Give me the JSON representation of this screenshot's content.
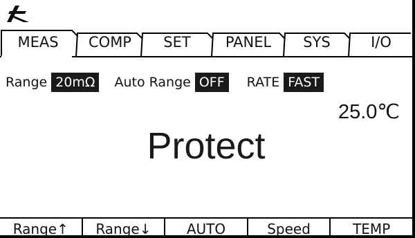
{
  "tabs": [
    {
      "label": "MEAS",
      "active": true
    },
    {
      "label": "COMP",
      "active": false
    },
    {
      "label": "SET",
      "active": false
    },
    {
      "label": "PANEL",
      "active": false
    },
    {
      "label": "SYS",
      "active": false
    },
    {
      "label": "I/O",
      "active": false
    }
  ],
  "info": {
    "range_label": "Range",
    "range_value": "20mΩ",
    "auto_range_label": "Auto Range",
    "auto_range_value": "OFF",
    "rate_label": "RATE",
    "rate_value": "FAST"
  },
  "temperature": "25.0℃",
  "status_message": "Protect",
  "softkeys": [
    "Range↑",
    "Range↓",
    "AUTO",
    "Speed",
    "TEMP"
  ],
  "colors": {
    "highlight_bg": "#1a1a1a",
    "highlight_fg": "#ffffff",
    "background": "#ffffff"
  },
  "logo_icon": "brand-logo-icon"
}
